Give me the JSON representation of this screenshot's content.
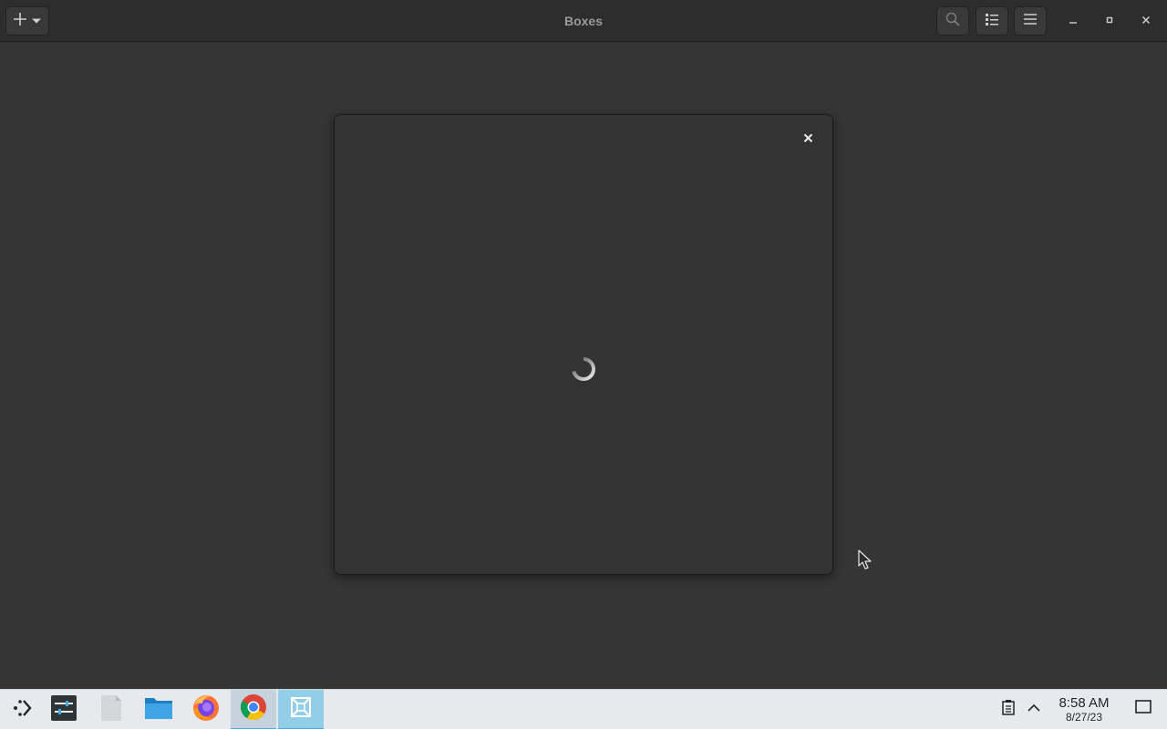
{
  "window": {
    "title": "Boxes"
  },
  "header": {
    "new_button_icon": "plus-icon",
    "dropdown_icon": "chevron-down-icon",
    "search_icon": "search-icon",
    "view_icon": "list-view-icon",
    "menu_icon": "hamburger-menu-icon"
  },
  "dialog": {
    "state": "loading",
    "close_icon": "close-icon"
  },
  "taskbar": {
    "apps": [
      {
        "name": "application-launcher",
        "icon": "launcher-icon"
      },
      {
        "name": "system-settings",
        "icon": "settings-icon"
      },
      {
        "name": "text-editor",
        "icon": "document-icon"
      },
      {
        "name": "file-manager",
        "icon": "folder-icon"
      },
      {
        "name": "firefox",
        "icon": "firefox-icon"
      },
      {
        "name": "chrome",
        "icon": "chrome-icon",
        "active": true
      },
      {
        "name": "boxes",
        "icon": "boxes-icon",
        "active": true
      }
    ],
    "clock": {
      "time": "8:58 AM",
      "date": "8/27/23"
    }
  },
  "colors": {
    "window_bg": "#353535",
    "headerbar_bg": "#2d2d2d",
    "dialog_bg": "#333333",
    "taskbar_bg": "#e7eaec",
    "accent": "#3daee9"
  }
}
